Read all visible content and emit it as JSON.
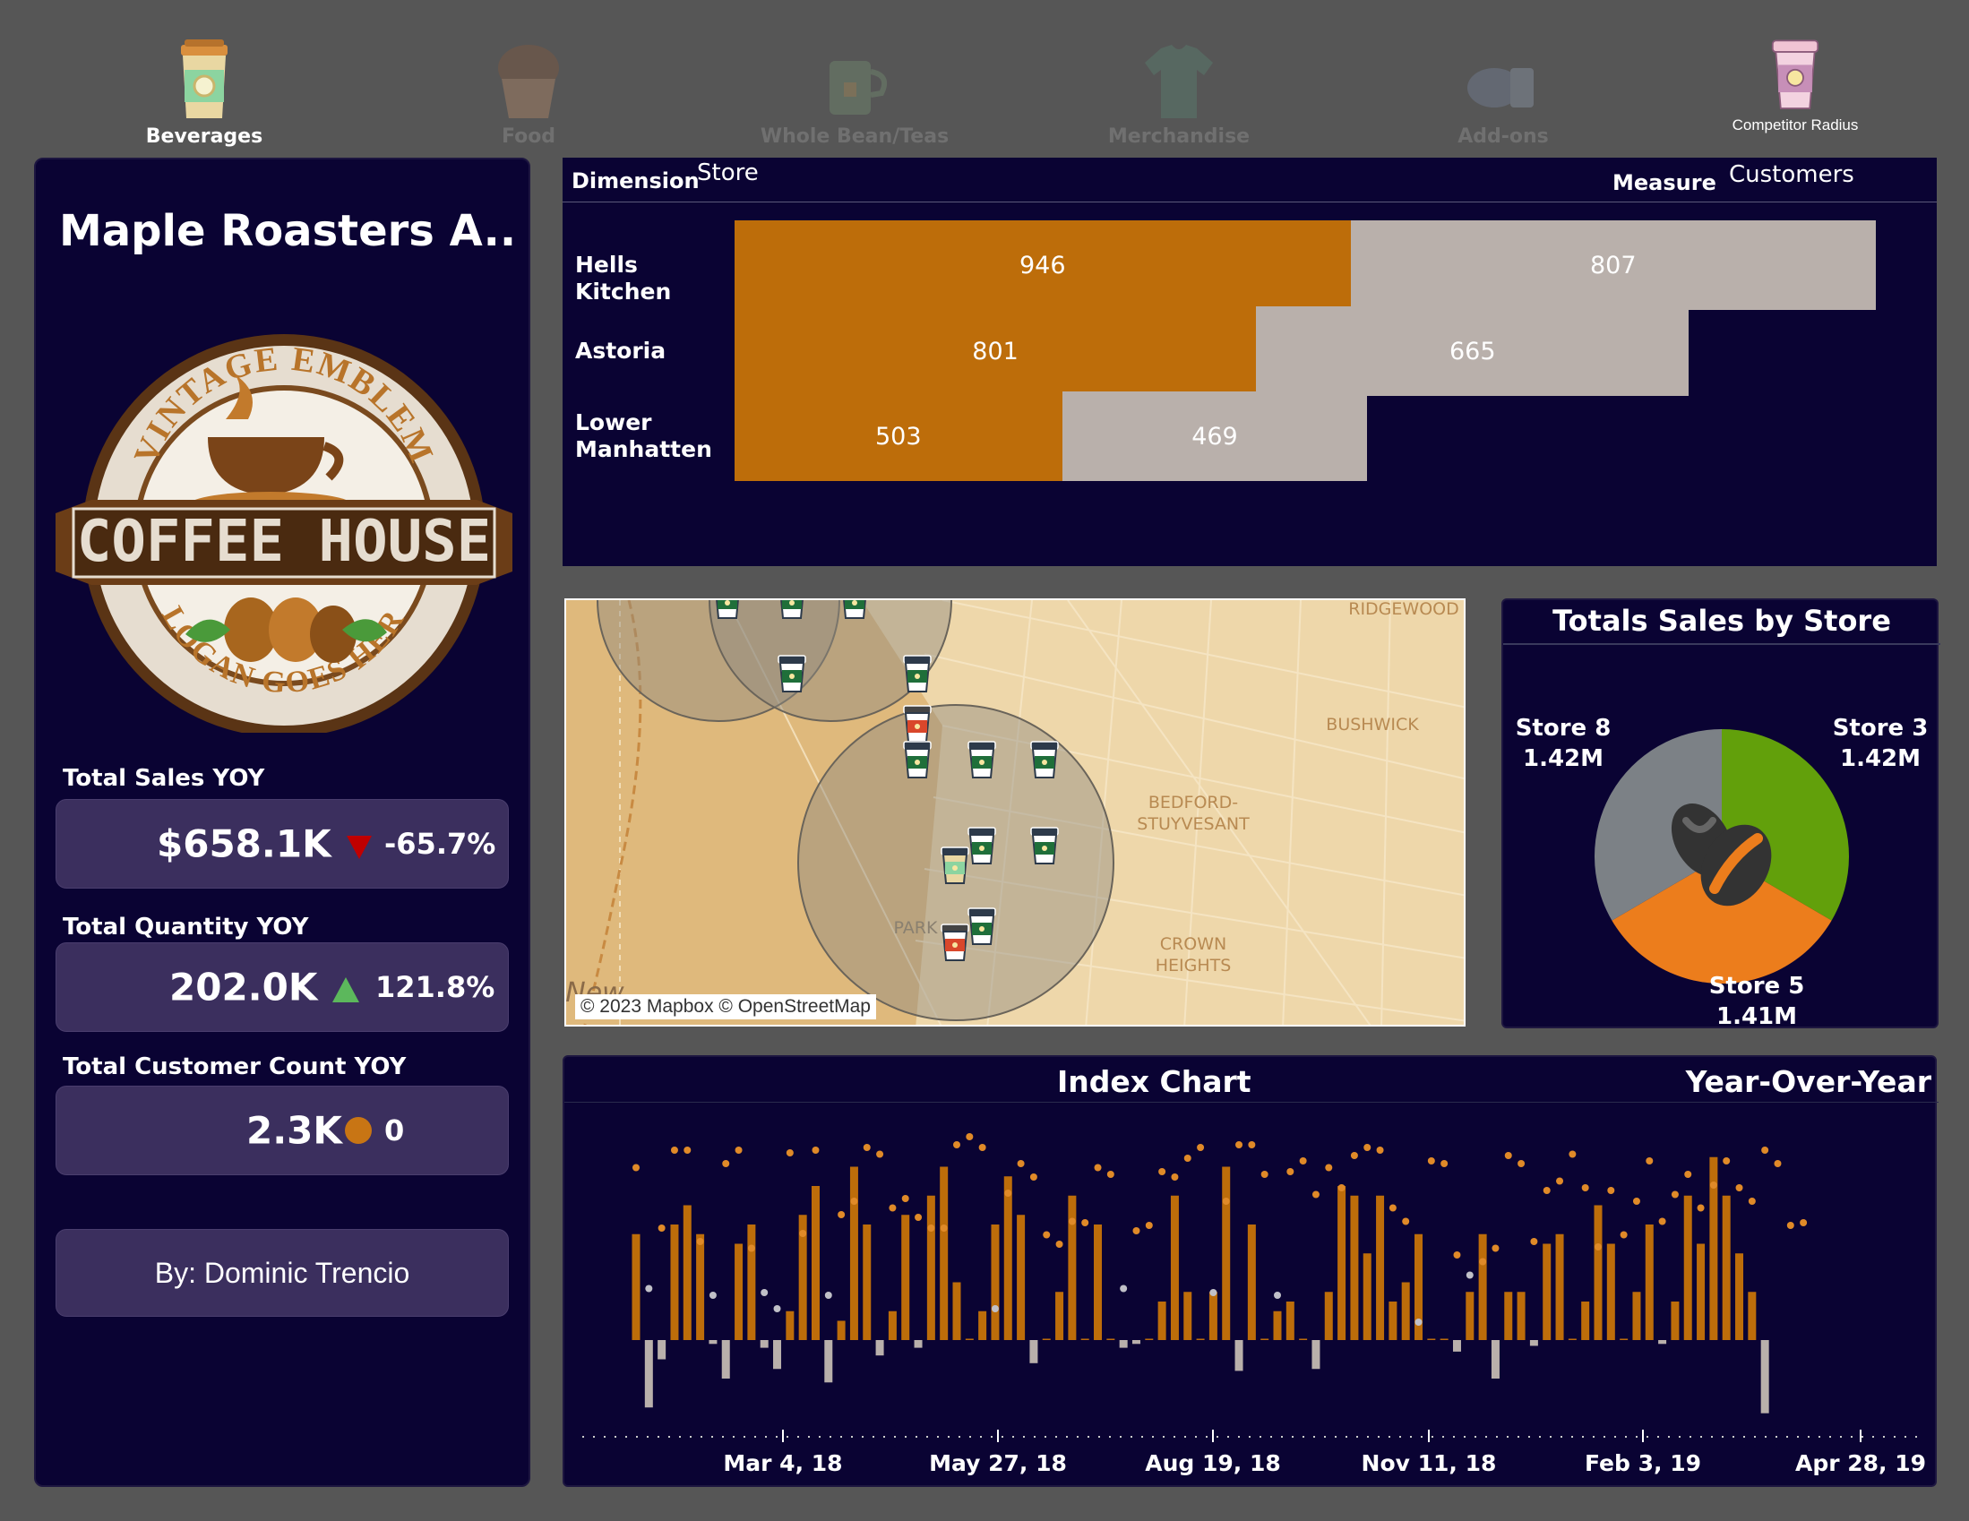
{
  "nav": {
    "items": [
      {
        "label": "Beverages",
        "icon": "coffee-cup-icon",
        "active": true
      },
      {
        "label": "Food",
        "icon": "muffin-icon",
        "active": false
      },
      {
        "label": "Whole Bean/Teas",
        "icon": "tea-mug-icon",
        "active": false
      },
      {
        "label": "Merchandise",
        "icon": "tshirt-icon",
        "active": false
      },
      {
        "label": "Add-ons",
        "icon": "bowl-cup-icon",
        "active": false
      },
      {
        "label": "Competitor Radius",
        "icon": "pink-cup-icon",
        "active": false
      }
    ]
  },
  "left": {
    "title": "Maple Roasters A..",
    "logo": {
      "top_text": "VINTAGE EMBLEM",
      "banner": "COFFEE HOUSE",
      "bottom_text": "SLOGAN GOES HERE"
    },
    "kpis": [
      {
        "label": "Total Sales YOY",
        "value": "$658.1K",
        "delta": "-65.7%",
        "indicator": "down-triangle-icon",
        "indicator_color": "#c00000"
      },
      {
        "label": "Total Quantity YOY",
        "value": "202.0K",
        "delta": "121.8%",
        "indicator": "up-triangle-icon",
        "indicator_color": "#5cb85c"
      },
      {
        "label": "Total Customer Count YOY",
        "value": "2.3K",
        "delta": "0",
        "indicator": "circle-icon",
        "indicator_color": "#c87514"
      }
    ],
    "author": "By: Dominic Trencio"
  },
  "bar_panel": {
    "dimension_label": "Dimension",
    "dimension_value": "Store",
    "measure_label": "Measure",
    "measure_value": "Customers"
  },
  "map": {
    "attribution": "© 2023 Mapbox © OpenStreetMap",
    "place_labels": [
      "RIDGEWOOD",
      "BUSHWICK",
      "BEDFORD-",
      "STUYVESANT",
      "CROWN",
      "HEIGHTS",
      "PARK",
      "New"
    ]
  },
  "pie_panel": {
    "title": "Totals Sales by Store"
  },
  "index_panel": {
    "title": "Index Chart",
    "subtitle": "Year-Over-Year"
  },
  "chart_data": [
    {
      "type": "bar",
      "stacked": true,
      "orientation": "horizontal",
      "categories": [
        "Hells Kitchen",
        "Astoria",
        "Lower Manhatten"
      ],
      "series": [
        {
          "values": [
            946,
            801,
            503
          ],
          "color": "#bd6d0a"
        },
        {
          "values": [
            807,
            665,
            469
          ],
          "color": "#b9b0ab"
        }
      ]
    },
    {
      "type": "pie",
      "title": "Totals Sales by Store",
      "slices": [
        {
          "label": "Store 3",
          "value": 1.42,
          "display": "1.42M",
          "color": "#62a00b"
        },
        {
          "label": "Store 5",
          "value": 1.41,
          "display": "1.41M",
          "color": "#ec7d1c"
        },
        {
          "label": "Store 8",
          "value": 1.42,
          "display": "1.42M",
          "color": "#7c8186"
        }
      ]
    },
    {
      "type": "bar",
      "title": "Index Chart",
      "x_tick_labels": [
        "Mar 4, 18",
        "May 27, 18",
        "Aug 19, 18",
        "Nov 11, 18",
        "Feb 3, 19",
        "Apr 28, 19"
      ],
      "positive_color": "#bd6d0a",
      "negative_color": "#b9b0ab",
      "values": [
        55,
        -35,
        -10,
        60,
        70,
        55,
        -2,
        -20,
        50,
        60,
        -4,
        -15,
        15,
        65,
        80,
        -22,
        10,
        90,
        60,
        -8,
        15,
        65,
        -4,
        75,
        90,
        30,
        0,
        15,
        60,
        85,
        65,
        -12,
        0,
        25,
        75,
        0,
        60,
        0,
        -4,
        -2,
        0,
        20,
        75,
        25,
        0,
        25,
        90,
        -16,
        60,
        0,
        15,
        20,
        0,
        -15,
        25,
        80,
        75,
        45,
        75,
        20,
        30,
        55,
        0,
        0,
        -6,
        25,
        55,
        -20,
        25,
        25,
        -3,
        50,
        55,
        0,
        20,
        70,
        50,
        0,
        25,
        60,
        -2,
        20,
        75,
        50,
        95,
        75,
        45,
        25,
        -38
      ],
      "markers": [
        75,
        -15,
        30,
        88,
        88,
        20,
        -20,
        78,
        88,
        15,
        -18,
        -30,
        86,
        26,
        88,
        -20,
        40,
        50,
        90,
        85,
        45,
        52,
        38,
        30,
        30,
        92,
        98,
        90,
        -30,
        56,
        78,
        68,
        25,
        18,
        35,
        34,
        75,
        70,
        -15,
        28,
        32,
        72,
        68,
        82,
        90,
        -18,
        50,
        92,
        92,
        70,
        -20,
        72,
        80,
        55,
        75,
        60,
        84,
        90,
        88,
        45,
        35,
        -40,
        80,
        78,
        10,
        -5,
        5,
        15,
        84,
        78,
        20,
        58,
        65,
        85,
        60,
        16,
        58,
        25,
        50,
        80,
        35,
        55,
        70,
        45,
        62,
        80,
        60,
        50,
        88,
        78,
        32,
        34
      ]
    }
  ]
}
